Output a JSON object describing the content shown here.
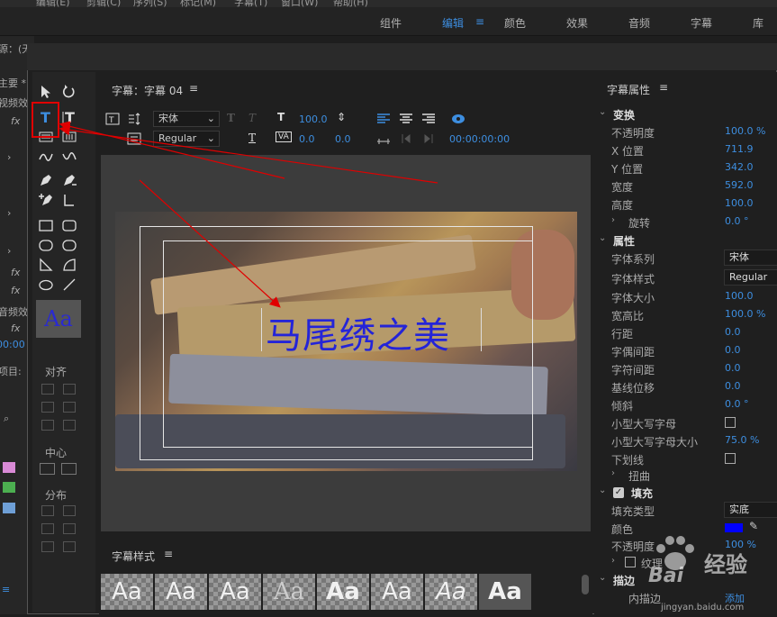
{
  "menu": [
    "编辑(E)",
    "剪辑(C)",
    "序列(S)",
    "标记(M)",
    "字幕(T)",
    "窗口(W)",
    "帮助(H)"
  ],
  "workspaces": [
    {
      "label": "组件",
      "active": false
    },
    {
      "label": "编辑",
      "active": true
    },
    {
      "label": "颜色",
      "active": false
    },
    {
      "label": "效果",
      "active": false
    },
    {
      "label": "音频",
      "active": false
    },
    {
      "label": "字幕",
      "active": false
    },
    {
      "label": "库",
      "active": false
    }
  ],
  "bg_panel": {
    "source_label": "源：(无剪辑)",
    "main_label": "主要 *",
    "video_fx": "视频效果",
    "audio_fx": "音频效果",
    "fx": "fx",
    "project": "项目:",
    "timecode": "00:00",
    "search_icon": "search-icon"
  },
  "editor": {
    "title_label": "字幕：字幕 04",
    "menu_icon": "≡",
    "font_family": "宋体",
    "font_style": "Regular",
    "size_value": "100.0",
    "kerning_value": "0.0",
    "leading_value": "0.0",
    "timecode": "00:00:00:00",
    "title_text": "马尾绣之美"
  },
  "tools": {
    "align_label": "对齐",
    "center_label": "中心",
    "distribute_label": "分布",
    "preview_text": "Aa"
  },
  "styles_panel": {
    "title": "字幕样式",
    "swatches": [
      "Aa",
      "Aa",
      "Aa",
      "Aa",
      "Aa",
      "Aa",
      "Aa",
      "Aa"
    ]
  },
  "props": {
    "title": "字幕属性",
    "transform": {
      "label": "变换",
      "opacity": {
        "label": "不透明度",
        "value": "100.0 %"
      },
      "x": {
        "label": "X 位置",
        "value": "711.9"
      },
      "y": {
        "label": "Y 位置",
        "value": "342.0"
      },
      "width": {
        "label": "宽度",
        "value": "592.0"
      },
      "height": {
        "label": "高度",
        "value": "100.0"
      },
      "rotation": {
        "label": "旋转",
        "value": "0.0 °"
      }
    },
    "properties": {
      "label": "属性",
      "font_family": {
        "label": "字体系列",
        "value": "宋体"
      },
      "font_style": {
        "label": "字体样式",
        "value": "Regular"
      },
      "font_size": {
        "label": "字体大小",
        "value": "100.0"
      },
      "aspect": {
        "label": "宽高比",
        "value": "100.0 %"
      },
      "leading": {
        "label": "行距",
        "value": "0.0"
      },
      "kerning": {
        "label": "字偶间距",
        "value": "0.0"
      },
      "tracking": {
        "label": "字符间距",
        "value": "0.0"
      },
      "baseline": {
        "label": "基线位移",
        "value": "0.0"
      },
      "slant": {
        "label": "倾斜",
        "value": "0.0 °"
      },
      "small_caps": {
        "label": "小型大写字母"
      },
      "small_caps_size": {
        "label": "小型大写字母大小",
        "value": "75.0 %"
      },
      "underline": {
        "label": "下划线"
      },
      "distort": {
        "label": "扭曲"
      }
    },
    "fill": {
      "label": "填充",
      "fill_type": {
        "label": "填充类型",
        "value": "实底"
      },
      "color": {
        "label": "颜色",
        "value": "#0000ff"
      },
      "opacity": {
        "label": "不透明度",
        "value": "100 %"
      },
      "texture": {
        "label": "纹理"
      }
    },
    "stroke": {
      "label": "描边",
      "inner": "内描边",
      "add": "添加"
    }
  },
  "watermark": {
    "brand": "Bai",
    "site": "经验",
    "url": "jingyan.baidu.com"
  },
  "accent": "#3d8ee0",
  "highlight": "#e00000"
}
